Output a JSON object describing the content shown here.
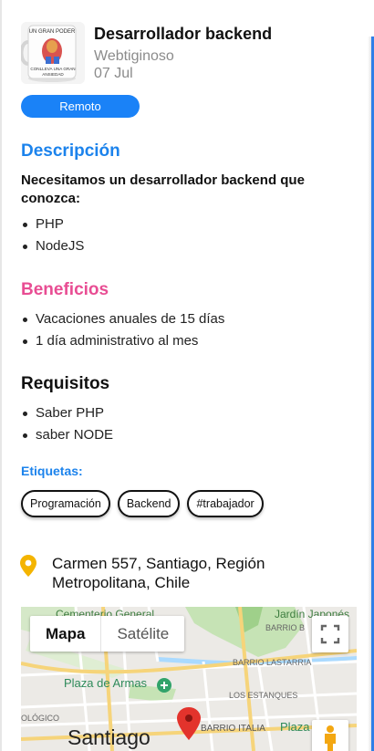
{
  "job": {
    "title": "Desarrollador backend",
    "company": "Webtiginoso",
    "date": "07 Jul",
    "modality": "Remoto",
    "thumbnail_text": [
      "UN GRAN PODER",
      "CONLLEVA UNA GRAN",
      "ANSIEDAD"
    ]
  },
  "description": {
    "heading": "Descripción",
    "intro": "Necesitamos un desarrollador backend que conozca:",
    "items": [
      "PHP",
      "NodeJS"
    ]
  },
  "benefits": {
    "heading": "Beneficios",
    "items": [
      "Vacaciones anuales de 15 días",
      "1 día administrativo al mes"
    ]
  },
  "requirements": {
    "heading": "Requisitos",
    "items": [
      "Saber PHP",
      "saber NODE"
    ]
  },
  "tags": {
    "label": "Etiquetas:",
    "items": [
      "Programación",
      "Backend",
      "#trabajador"
    ]
  },
  "location": {
    "address": "Carmen 557, Santiago, Región Metropolitana, Chile",
    "icon": "location-pin-icon"
  },
  "map": {
    "tab_map": "Mapa",
    "tab_satellite": "Satélite",
    "labels": {
      "cementerio": "Cementerio General",
      "jardin": "Jardín Japonés",
      "barrio_bellavista": "BARRIO B",
      "barrio_lastarria": "BARRIO LASTARRIA",
      "plaza_armas": "Plaza de Armas",
      "estanques": "LOS ESTANQUES",
      "barrio_italia": "BARRIO ITALIA",
      "plaza_short": "Plaza",
      "ologico": "OLÓGICO",
      "city": "Santiago"
    },
    "colors": {
      "park": "#c6e3b5",
      "road": "#f6d47a",
      "water": "#aadaff",
      "marker": "#e3332c"
    }
  },
  "colors": {
    "accent_blue": "#1c83ec",
    "chip_blue": "#1a82f7",
    "benefits_pink": "#e84d93",
    "pin_yellow": "#f4b400"
  }
}
